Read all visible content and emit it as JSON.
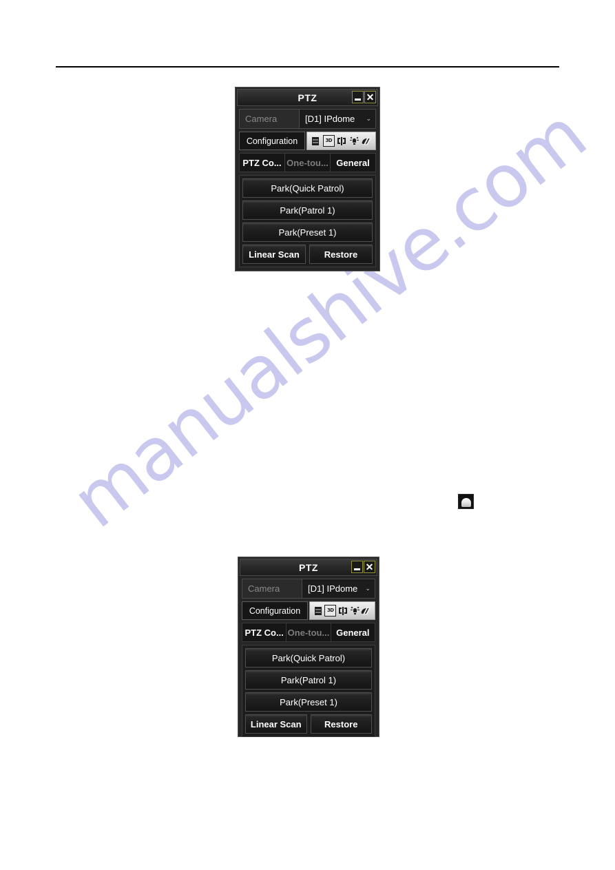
{
  "page": {
    "watermark_text": "manualshive.com",
    "watermark_color": "#c9c9ef",
    "rule_color": "#000000"
  },
  "dome_icon": {
    "name": "ptz-dome-camera-icon"
  },
  "ptz_panel": {
    "title": "PTZ",
    "window_buttons": {
      "minimize": "_",
      "close": "✕"
    },
    "camera": {
      "label": "Camera",
      "selected": "[D1] IPdome",
      "caret": "⌄"
    },
    "configuration": {
      "label": "Configuration",
      "icons": [
        {
          "name": "menu-icon",
          "glyph": "menu",
          "boxed": false,
          "label": "Menu"
        },
        {
          "name": "three-d-zoom-icon",
          "glyph": "3D",
          "boxed": true,
          "label": "3D"
        },
        {
          "name": "focus-frame-icon",
          "glyph": "frame",
          "boxed": false,
          "label": "Center"
        },
        {
          "name": "light-icon",
          "glyph": "light",
          "boxed": false,
          "label": "Light"
        },
        {
          "name": "wiper-icon",
          "glyph": "wiper",
          "boxed": false,
          "label": "Wiper"
        }
      ]
    },
    "tabs": [
      {
        "label": "PTZ Co...",
        "state": "normal"
      },
      {
        "label": "One-tou...",
        "state": "dim"
      },
      {
        "label": "General",
        "state": "active"
      }
    ],
    "buttons": {
      "park_quick_patrol": "Park(Quick Patrol)",
      "park_patrol_1": "Park(Patrol 1)",
      "park_preset_1": "Park(Preset 1)",
      "linear_scan": "Linear Scan",
      "restore": "Restore"
    }
  }
}
